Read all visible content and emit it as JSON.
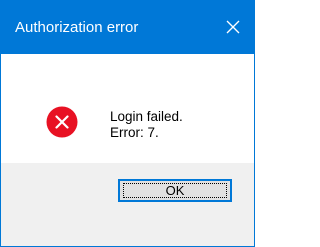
{
  "dialog": {
    "title": "Authorization error",
    "close_icon": "close-icon",
    "error_icon": "error-x-circle-icon",
    "message_lines": [
      "Login failed.",
      "Error: 7."
    ],
    "ok_label": "OK"
  },
  "colors": {
    "titlebar": "#0078d7",
    "error_icon": "#e81123",
    "footer": "#f0f0f0",
    "button_face": "#e1e1e1",
    "button_border": "#0078d7"
  }
}
